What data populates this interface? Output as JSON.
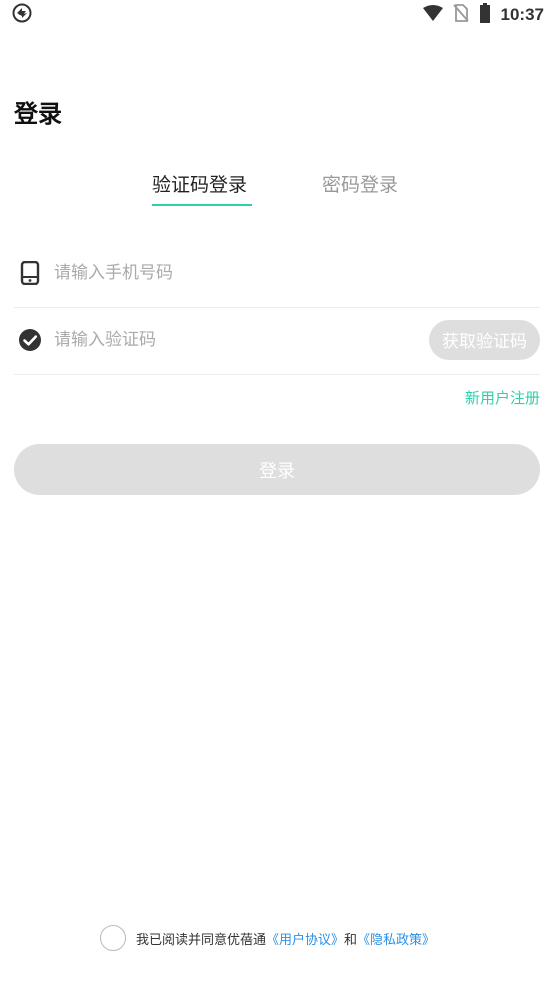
{
  "status_bar": {
    "time": "10:37",
    "icons": [
      "sync-icon",
      "wifi-icon",
      "no-sim-icon",
      "battery-icon"
    ]
  },
  "page": {
    "title": "登录"
  },
  "tabs": [
    {
      "label": "验证码登录",
      "active": true
    },
    {
      "label": "密码登录",
      "active": false
    }
  ],
  "form": {
    "phone_placeholder": "请输入手机号码",
    "phone_value": "",
    "code_placeholder": "请输入验证码",
    "code_value": "",
    "get_code_label": "获取验证码",
    "register_label": "新用户注册",
    "login_label": "登录"
  },
  "agreement": {
    "prefix": "我已阅读并同意优蓓通",
    "user_agreement": "《用户协议》",
    "conjunction": "和",
    "privacy_policy": "《隐私政策》"
  },
  "colors": {
    "accent": "#2fcfaa",
    "link": "#2b8fe6",
    "disabled": "#dedede"
  }
}
